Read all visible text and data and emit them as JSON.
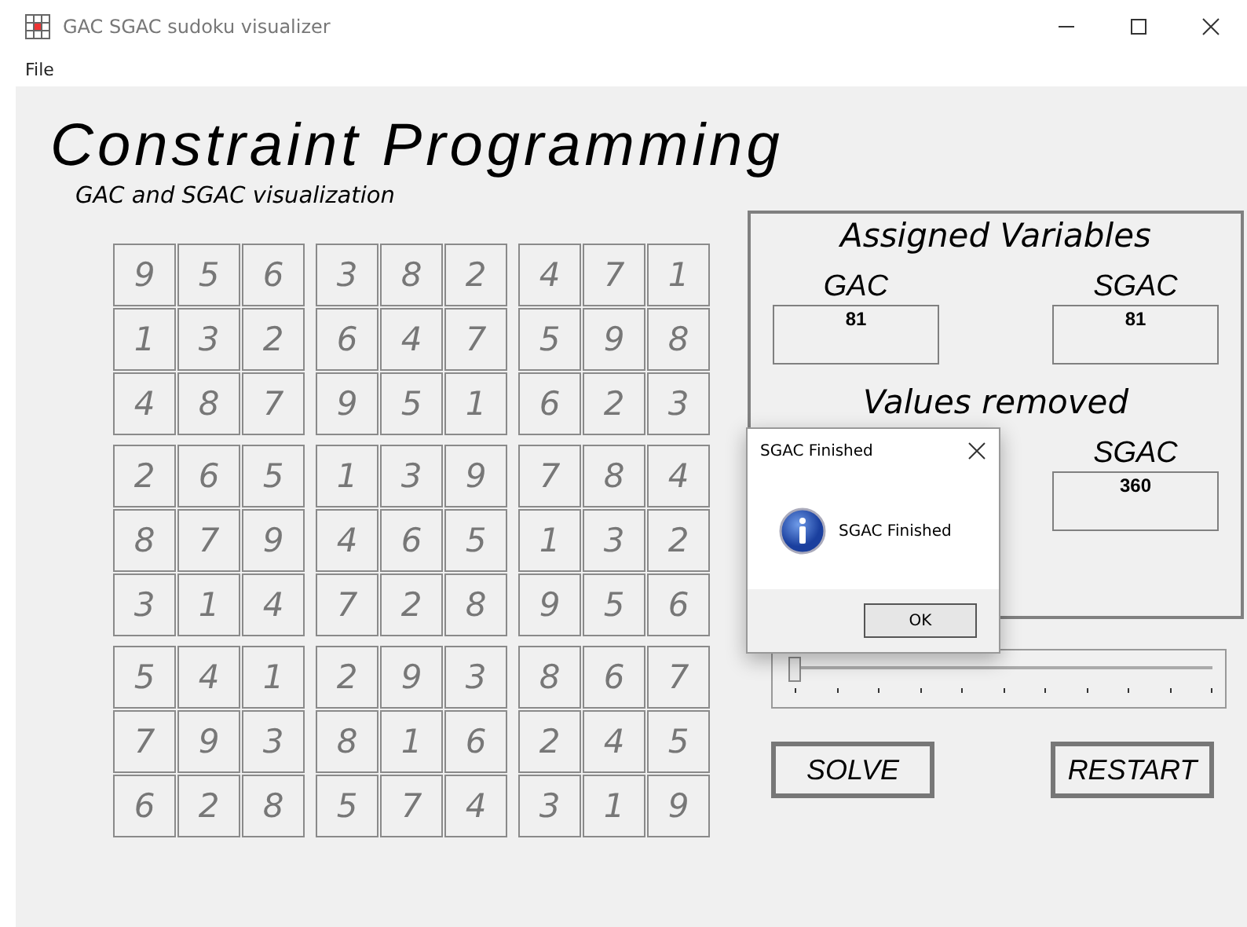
{
  "window": {
    "title": "GAC SGAC sudoku visualizer"
  },
  "menu": [
    "File"
  ],
  "heading": "Constraint Programming",
  "subheading": "GAC and SGAC visualization",
  "grid": [
    [
      "9",
      "5",
      "6",
      "3",
      "8",
      "2",
      "4",
      "7",
      "1"
    ],
    [
      "1",
      "3",
      "2",
      "6",
      "4",
      "7",
      "5",
      "9",
      "8"
    ],
    [
      "4",
      "8",
      "7",
      "9",
      "5",
      "1",
      "6",
      "2",
      "3"
    ],
    [
      "2",
      "6",
      "5",
      "1",
      "3",
      "9",
      "7",
      "8",
      "4"
    ],
    [
      "8",
      "7",
      "9",
      "4",
      "6",
      "5",
      "1",
      "3",
      "2"
    ],
    [
      "3",
      "1",
      "4",
      "7",
      "2",
      "8",
      "9",
      "5",
      "6"
    ],
    [
      "5",
      "4",
      "1",
      "2",
      "9",
      "3",
      "8",
      "6",
      "7"
    ],
    [
      "7",
      "9",
      "3",
      "8",
      "1",
      "6",
      "2",
      "4",
      "5"
    ],
    [
      "6",
      "2",
      "8",
      "5",
      "7",
      "4",
      "3",
      "1",
      "9"
    ]
  ],
  "assigned": {
    "title": "Assigned Variables",
    "gac_label": "GAC",
    "gac_value": "81",
    "sgac_label": "SGAC",
    "sgac_value": "81"
  },
  "values_removed": {
    "title": "Values removed",
    "sgac_label": "SGAC",
    "sgac_value": "360"
  },
  "slider": {
    "level": 0
  },
  "buttons": [
    "SOLVE",
    "RESTART"
  ],
  "dialog": {
    "title": "SGAC Finished",
    "message": "SGAC Finished",
    "ok": "OK"
  }
}
